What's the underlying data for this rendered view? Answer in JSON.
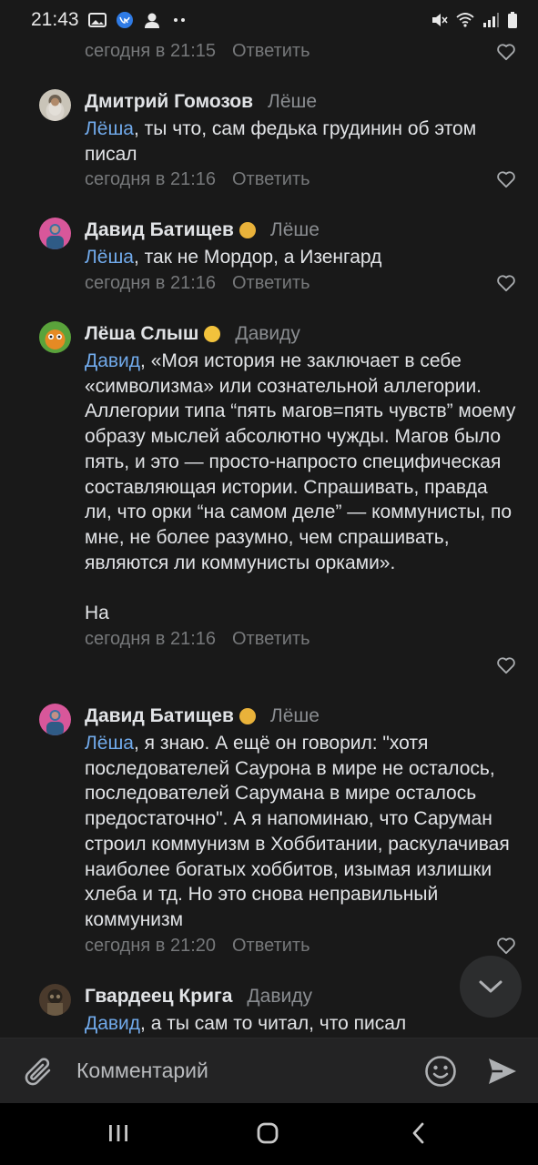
{
  "status_bar": {
    "time": "21:43",
    "left_icons": [
      "gallery-icon",
      "vk-icon",
      "person-icon",
      "more-dots-icon"
    ],
    "right_icons": [
      "mute-icon",
      "wifi-icon",
      "signal-icon",
      "battery-icon"
    ]
  },
  "comments": [
    {
      "id": "c0",
      "author": "",
      "reply_to": "",
      "mention": "",
      "text": "",
      "timestamp": "сегодня в 21:15",
      "reply_label": "Ответить"
    },
    {
      "id": "c1",
      "author": "Дмитрий Гомозов",
      "reply_to": "Лёше",
      "mention": "Лёша",
      "text": ", ты что, сам федька грудинин об этом писал",
      "timestamp": "сегодня в 21:16",
      "reply_label": "Ответить",
      "avatar": "bearded-man-portrait"
    },
    {
      "id": "c2",
      "author": "Давид Батищев",
      "badge": "cowboy-emoji",
      "reply_to": "Лёше",
      "mention": "Лёша",
      "text": ", так не Мордор, а Изенгард",
      "timestamp": "сегодня в 21:16",
      "reply_label": "Ответить",
      "avatar": "pink-portrait"
    },
    {
      "id": "c3",
      "author": "Лёша Слыш",
      "badge": "tongue-emoji",
      "reply_to": "Давиду",
      "mention": "Давид",
      "text": ", «Моя история не заключает в себе «символизма» или сознательной аллегории. Аллегории типа “пять магов=пять чувств” моему образу мыслей абсолютно чужды. Магов было пять, и это — просто-напросто специфическая составляющая истории. Спрашивать, правда ли, что орки “на самом деле” — коммунисты, по мне, не более разумно, чем спрашивать, являются ли коммунисты орками».\n\nНа",
      "timestamp": "сегодня в 21:16",
      "reply_label": "Ответить",
      "avatar": "green-cartoon"
    },
    {
      "id": "c4",
      "author": "Давид Батищев",
      "badge": "cowboy-emoji",
      "reply_to": "Лёше",
      "mention": "Лёша",
      "text": ", я знаю. А ещё он говорил: \"хотя последователей Саурона в мире не осталось, последователей Сарумана в мире осталось предостаточно\". А я напоминаю, что Саруман строил коммунизм в Хоббитании, раскулачивая наиболее богатых хоббитов, изымая излишки хлеба и тд. Но это снова неправильный коммунизм",
      "timestamp": "сегодня в 21:20",
      "reply_label": "Ответить",
      "avatar": "pink-portrait"
    },
    {
      "id": "c5",
      "author": "Гвардеец Крига",
      "reply_to": "Давиду",
      "mention": "Давид",
      "text": ", а ты сам то читал, что писал",
      "timestamp": "",
      "reply_label": "",
      "avatar": "soldier-portrait"
    }
  ],
  "composer": {
    "placeholder": "Комментарий",
    "icons": [
      "attach-icon",
      "emoji-icon",
      "send-icon"
    ]
  },
  "scroll_button": {
    "icon": "chevron-down-icon"
  },
  "nav_bar": {
    "icons": [
      "recents-icon",
      "home-icon",
      "back-icon"
    ]
  },
  "colors": {
    "background": "#191919",
    "text": "#e1e3e6",
    "secondary": "#76787a",
    "mention": "#71aaeb",
    "composer": "#232324"
  }
}
